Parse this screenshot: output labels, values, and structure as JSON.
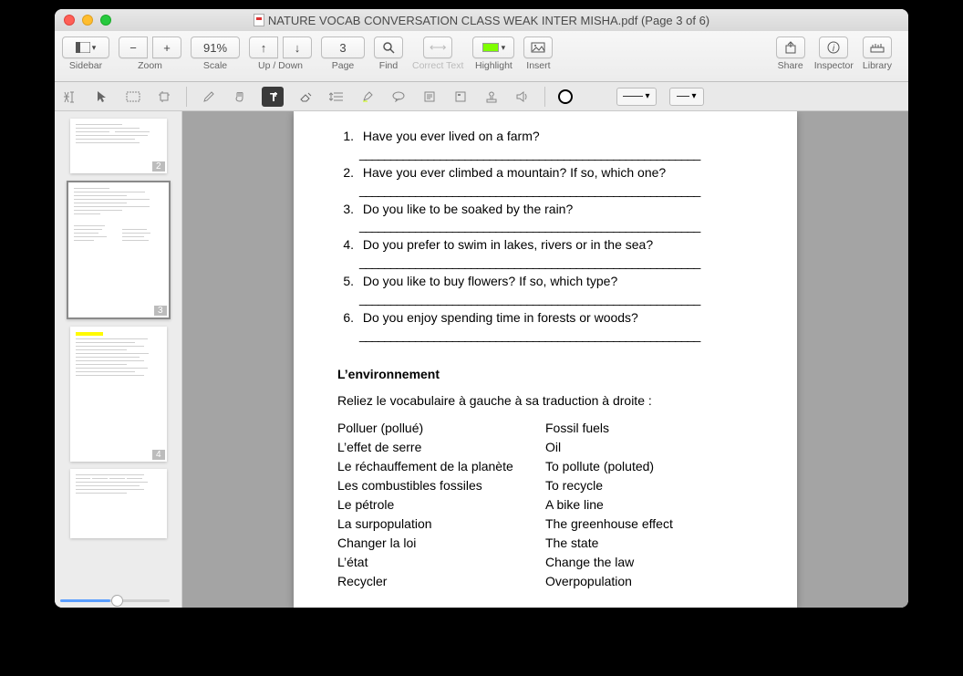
{
  "window": {
    "title": "NATURE VOCAB CONVERSATION CLASS WEAK INTER MISHA.pdf (Page 3 of 6)"
  },
  "toolbar": {
    "sidebar_label": "Sidebar",
    "zoom_label": "Zoom",
    "zoom_value": "91%",
    "scale_label": "Scale",
    "updown_label": "Up / Down",
    "page_label": "Page",
    "page_value": "3",
    "find_label": "Find",
    "correct_label": "Correct Text",
    "highlight_label": "Highlight",
    "insert_label": "Insert",
    "share_label": "Share",
    "inspector_label": "Inspector",
    "library_label": "Library"
  },
  "thumbs": {
    "p2": "2",
    "p3": "3",
    "p4": "4"
  },
  "doc": {
    "questions": [
      "Have you ever lived on a farm?",
      "Have you ever climbed a mountain? If so, which one?",
      "Do you like to be soaked by the rain?",
      "Do you prefer to swim in lakes, rivers or in the sea?",
      "Do you like to buy flowers? If so, which type?",
      "Do you enjoy spending time in forests or woods?"
    ],
    "blank": "_______________________________________________________",
    "section_title": "L’environnement",
    "instruction": "Reliez le vocabulaire à gauche à sa traduction à droite :",
    "left_col": [
      "Polluer (pollué)",
      "L’effet de serre",
      "Le réchauffement de la planète",
      "Les combustibles fossiles",
      "Le pétrole",
      "La surpopulation",
      "Changer la loi",
      "L’état",
      "Recycler"
    ],
    "right_col": [
      "Fossil fuels",
      "Oil",
      "To pollute (poluted)",
      "To recycle",
      "A bike line",
      "The greenhouse effect",
      "The state",
      "Change the law",
      "Overpopulation"
    ]
  }
}
